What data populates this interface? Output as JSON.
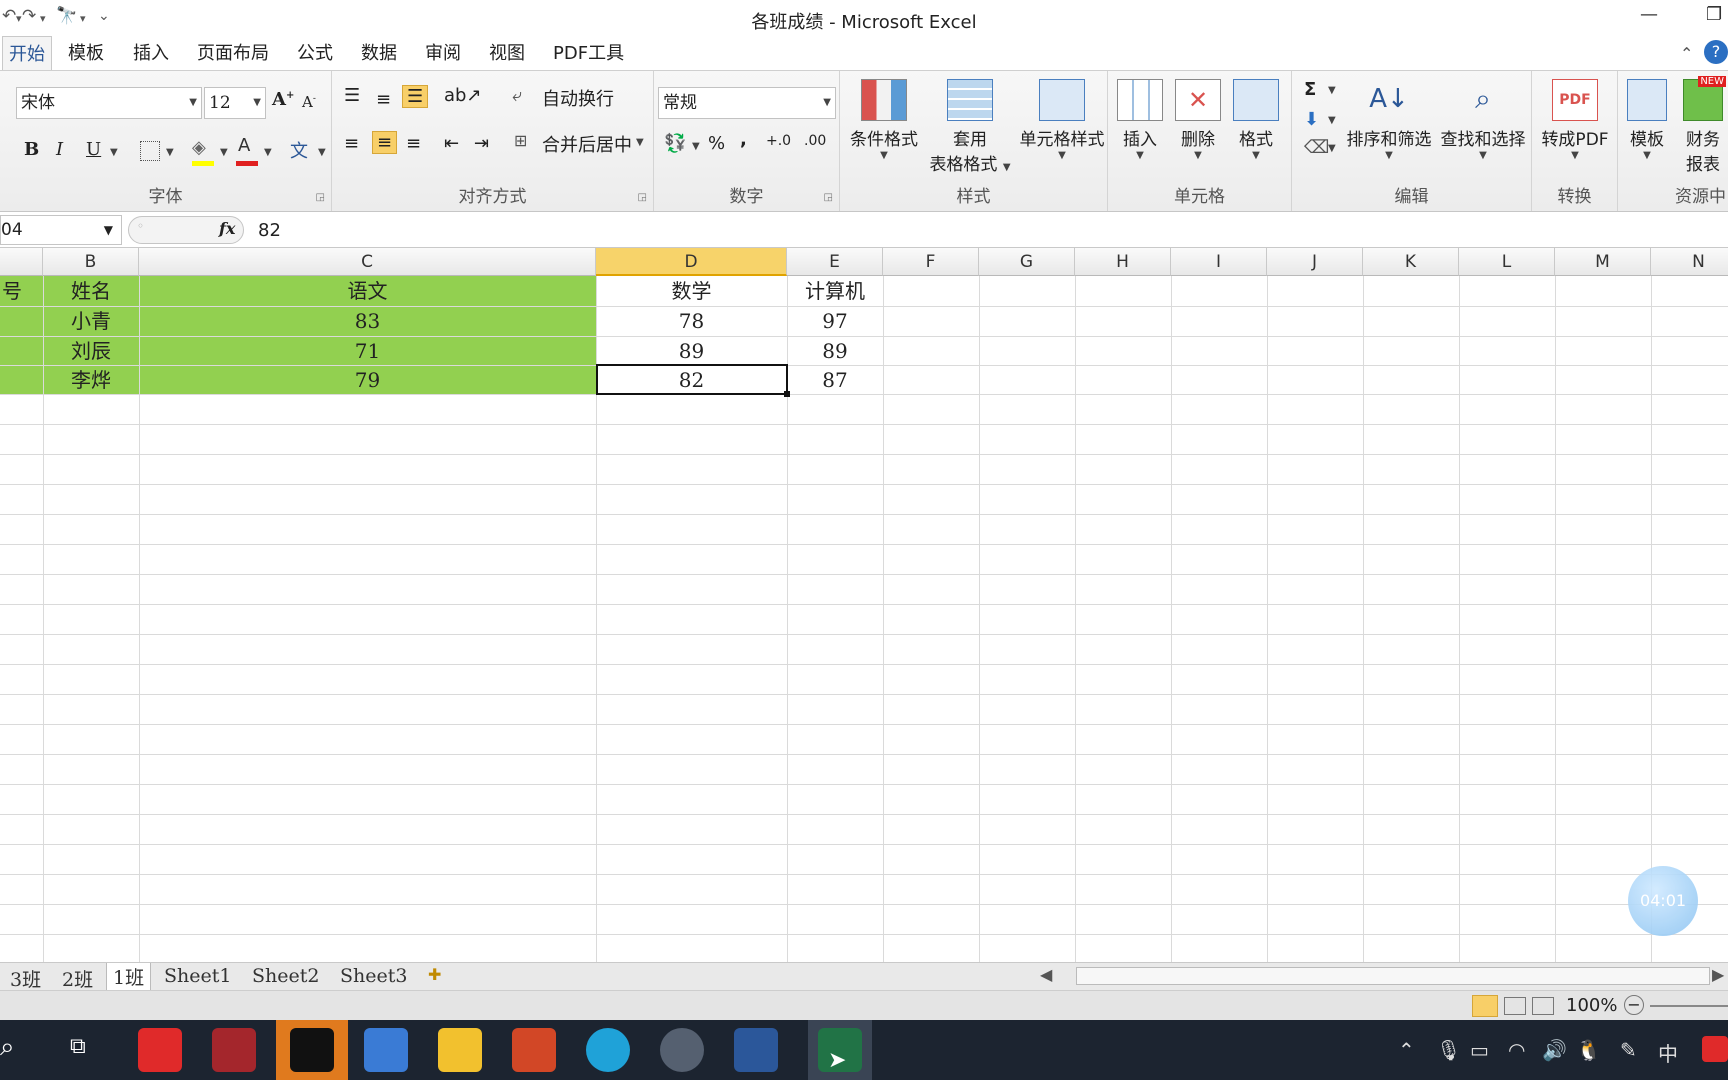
{
  "window": {
    "title": "各班成绩 - Microsoft Excel"
  },
  "tabs": [
    "开始",
    "模板",
    "插入",
    "页面布局",
    "公式",
    "数据",
    "审阅",
    "视图",
    "PDF工具"
  ],
  "ribbon": {
    "font": {
      "name": "宋体",
      "size": "12",
      "bold": "B",
      "italic": "I",
      "underline": "U",
      "label": "字体"
    },
    "align": {
      "wrap": "自动换行",
      "merge": "合并后居中",
      "label": "对齐方式"
    },
    "number": {
      "format": "常规",
      "percent": "%",
      "comma": ",",
      "label": "数字"
    },
    "styles": {
      "cond": "条件格式",
      "table_line1": "套用",
      "table_line2": "表格格式",
      "cell": "单元格样式",
      "label": "样式"
    },
    "cells": {
      "insert": "插入",
      "delete": "删除",
      "format": "格式",
      "label": "单元格"
    },
    "edit": {
      "sum": "Σ",
      "sort": "排序和筛选",
      "find": "查找和选择",
      "label": "编辑"
    },
    "convert": {
      "pdf": "转成PDF",
      "label": "转换"
    },
    "resource": {
      "template": "模板",
      "finance_line1": "财务",
      "finance_line2": "报表",
      "label": "资源中",
      "new_badge": "NEW"
    }
  },
  "formula_bar": {
    "name_box": "04",
    "fx": "fx",
    "value": "82"
  },
  "columns": [
    "B",
    "C",
    "D",
    "E",
    "F",
    "G",
    "H",
    "I",
    "J",
    "K",
    "L",
    "M",
    "N"
  ],
  "rows": [
    {
      "a": "号",
      "b": "姓名",
      "c": "语文",
      "d": "数学",
      "e": "计算机"
    },
    {
      "a": "",
      "b": "小青",
      "c": "83",
      "d": "78",
      "e": "97"
    },
    {
      "a": "",
      "b": "刘辰",
      "c": "71",
      "d": "89",
      "e": "89"
    },
    {
      "a": "",
      "b": "李烨",
      "c": "79",
      "d": "82",
      "e": "87"
    }
  ],
  "sheets": [
    "3班",
    "2班",
    "1班",
    "Sheet1",
    "Sheet2",
    "Sheet3"
  ],
  "status": {
    "zoom": "100%"
  },
  "overlay": {
    "timer": "04:01"
  },
  "tray": {
    "ime": "中"
  },
  "colors": {
    "green_fill": "#92d050",
    "selected_col": "#f7d36a",
    "accent": "#2b5797"
  }
}
